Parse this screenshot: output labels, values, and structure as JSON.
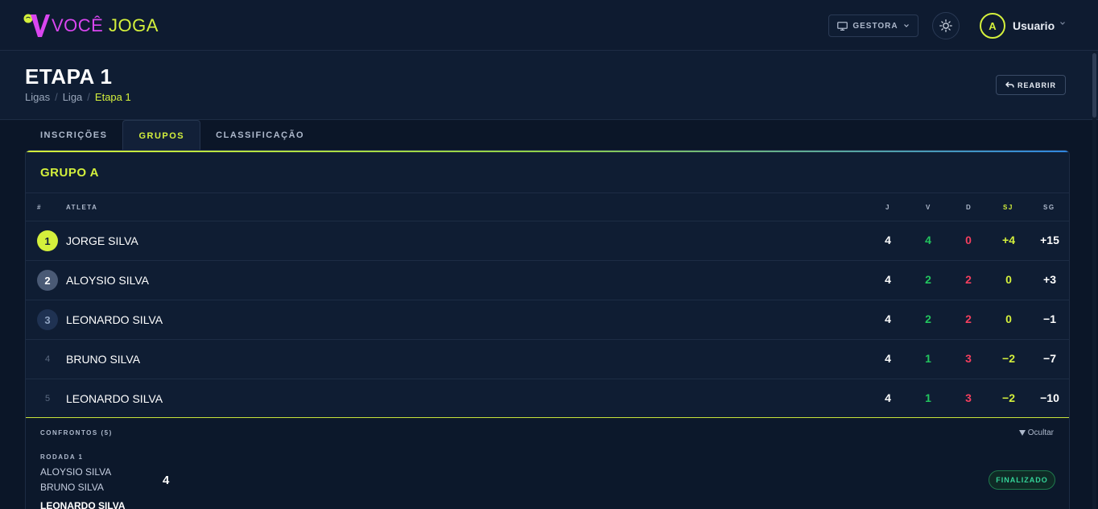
{
  "brand": {
    "part1": "VOCÊ",
    "part2": "JOGA"
  },
  "topbar": {
    "gestora_label": "GESTORA",
    "avatar_initial": "A",
    "user_name": "Usuario"
  },
  "header": {
    "title": "ETAPA 1",
    "breadcrumb": [
      "Ligas",
      "Liga",
      "Etapa 1"
    ],
    "reabrir_label": "REABRIR"
  },
  "tabs": [
    {
      "label": "INSCRIÇÕES",
      "active": false
    },
    {
      "label": "GRUPOS",
      "active": true
    },
    {
      "label": "CLASSIFICAÇÃO",
      "active": false
    }
  ],
  "group": {
    "title": "GRUPO A",
    "columns": [
      "#",
      "ATLETA",
      "J",
      "V",
      "D",
      "SJ",
      "SG"
    ],
    "rows": [
      {
        "rank": "1",
        "athlete": "JORGE SILVA",
        "j": "4",
        "v": "4",
        "d": "0",
        "sj": "+4",
        "sg": "+15"
      },
      {
        "rank": "2",
        "athlete": "ALOYSIO SILVA",
        "j": "4",
        "v": "2",
        "d": "2",
        "sj": "0",
        "sg": "+3"
      },
      {
        "rank": "3",
        "athlete": "LEONARDO SILVA",
        "j": "4",
        "v": "2",
        "d": "2",
        "sj": "0",
        "sg": "−1"
      },
      {
        "rank": "4",
        "athlete": "BRUNO SILVA",
        "j": "4",
        "v": "1",
        "d": "3",
        "sj": "−2",
        "sg": "−7"
      },
      {
        "rank": "5",
        "athlete": "LEONARDO SILVA",
        "j": "4",
        "v": "1",
        "d": "3",
        "sj": "−2",
        "sg": "−10"
      }
    ]
  },
  "confrontos": {
    "label": "CONFRONTOS (5)",
    "hide_label": "Ocultar",
    "round_label": "RODADA 1",
    "match": {
      "player1": "ALOYSIO SILVA",
      "player2": "BRUNO SILVA",
      "score": "4",
      "status": "FINALIZADO"
    },
    "next_player": "LEONARDO SILVA"
  },
  "colors": {
    "accent": "#d4f03c",
    "magenta": "#d946ef",
    "win": "#22c55e",
    "loss": "#f43f5e",
    "bg": "#0b1628"
  },
  "icons": [
    "monitor-icon",
    "chevron-down-icon",
    "sun-icon",
    "reply-icon",
    "triangle-down-icon"
  ]
}
